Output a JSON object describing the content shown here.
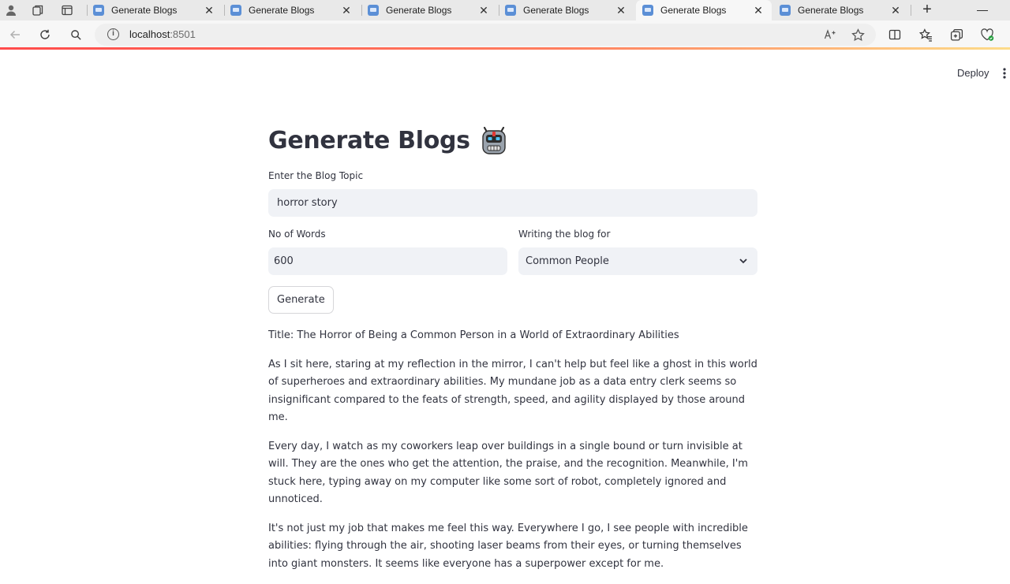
{
  "browser": {
    "tabs": [
      {
        "title": "Generate Blogs",
        "active": false
      },
      {
        "title": "Generate Blogs",
        "active": false
      },
      {
        "title": "Generate Blogs",
        "active": false
      },
      {
        "title": "Generate Blogs",
        "active": false
      },
      {
        "title": "Generate Blogs",
        "active": true
      },
      {
        "title": "Generate Blogs",
        "active": false
      }
    ],
    "url_host": "localhost",
    "url_port": ":8501"
  },
  "header": {
    "deploy_label": "Deploy"
  },
  "app": {
    "title": "Generate Blogs",
    "topic": {
      "label": "Enter the Blog Topic",
      "value": "horror story"
    },
    "words": {
      "label": "No of Words",
      "value": "600"
    },
    "audience": {
      "label": "Writing the blog for",
      "selected": "Common People"
    },
    "generate_label": "Generate"
  },
  "blog": {
    "paragraphs": [
      "Title: The Horror of Being a Common Person in a World of Extraordinary Abilities",
      "As I sit here, staring at my reflection in the mirror, I can't help but feel like a ghost in this world of superheroes and extraordinary abilities. My mundane job as a data entry clerk seems so insignificant compared to the feats of strength, speed, and agility displayed by those around me.",
      "Every day, I watch as my coworkers leap over buildings in a single bound or turn invisible at will. They are the ones who get the attention, the praise, and the recognition. Meanwhile, I'm stuck here, typing away on my computer like some sort of robot, completely ignored and unnoticed.",
      "It's not just my job that makes me feel this way. Everywhere I go, I see people with incredible abilities: flying through the air, shooting laser beams from their eyes, or turning themselves into giant monsters. It seems like everyone has a superpower except for me."
    ]
  }
}
